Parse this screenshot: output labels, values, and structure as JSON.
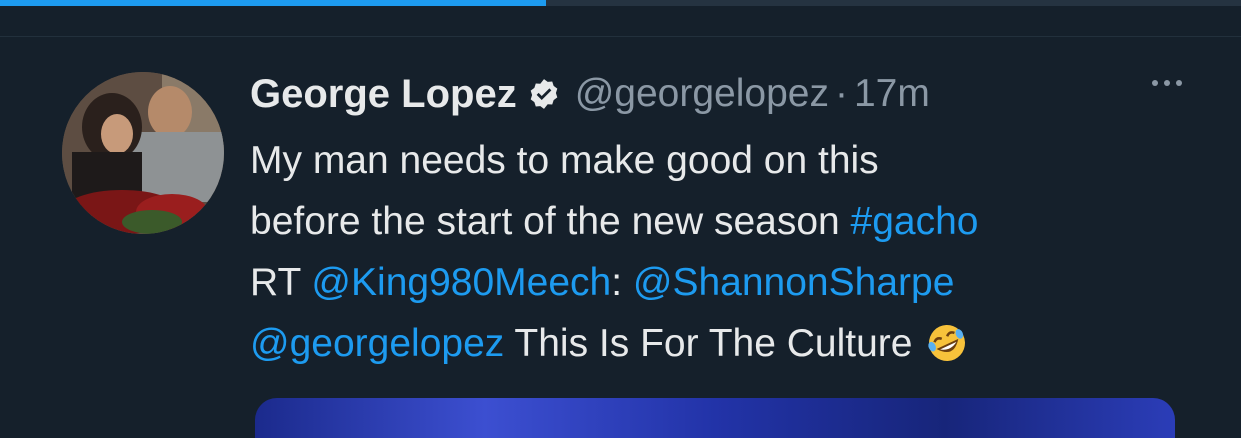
{
  "progress": {
    "fraction": 0.44
  },
  "tweet": {
    "author": {
      "display_name": "George Lopez",
      "handle": "@georgelopez",
      "verified": true
    },
    "separator": "·",
    "time": "17m",
    "text": {
      "line1": "My man needs to make good on this",
      "line2_pre": "before the start of the new season ",
      "hashtag": "#gacho",
      "rt_prefix": "RT ",
      "mention1": "@King980Meech",
      "colon": ": ",
      "mention2": "@ShannonSharpe",
      "mention3": "@georgelopez",
      "tail": " This Is For The Culture"
    },
    "more_icon": "more-horizontal-icon",
    "emoji": "rolling-on-floor-laughing-emoji-icon"
  },
  "colors": {
    "background": "#15202b",
    "link": "#1d9bf0",
    "secondary_text": "#8b98a5",
    "primary_text": "#e7e9ea"
  }
}
